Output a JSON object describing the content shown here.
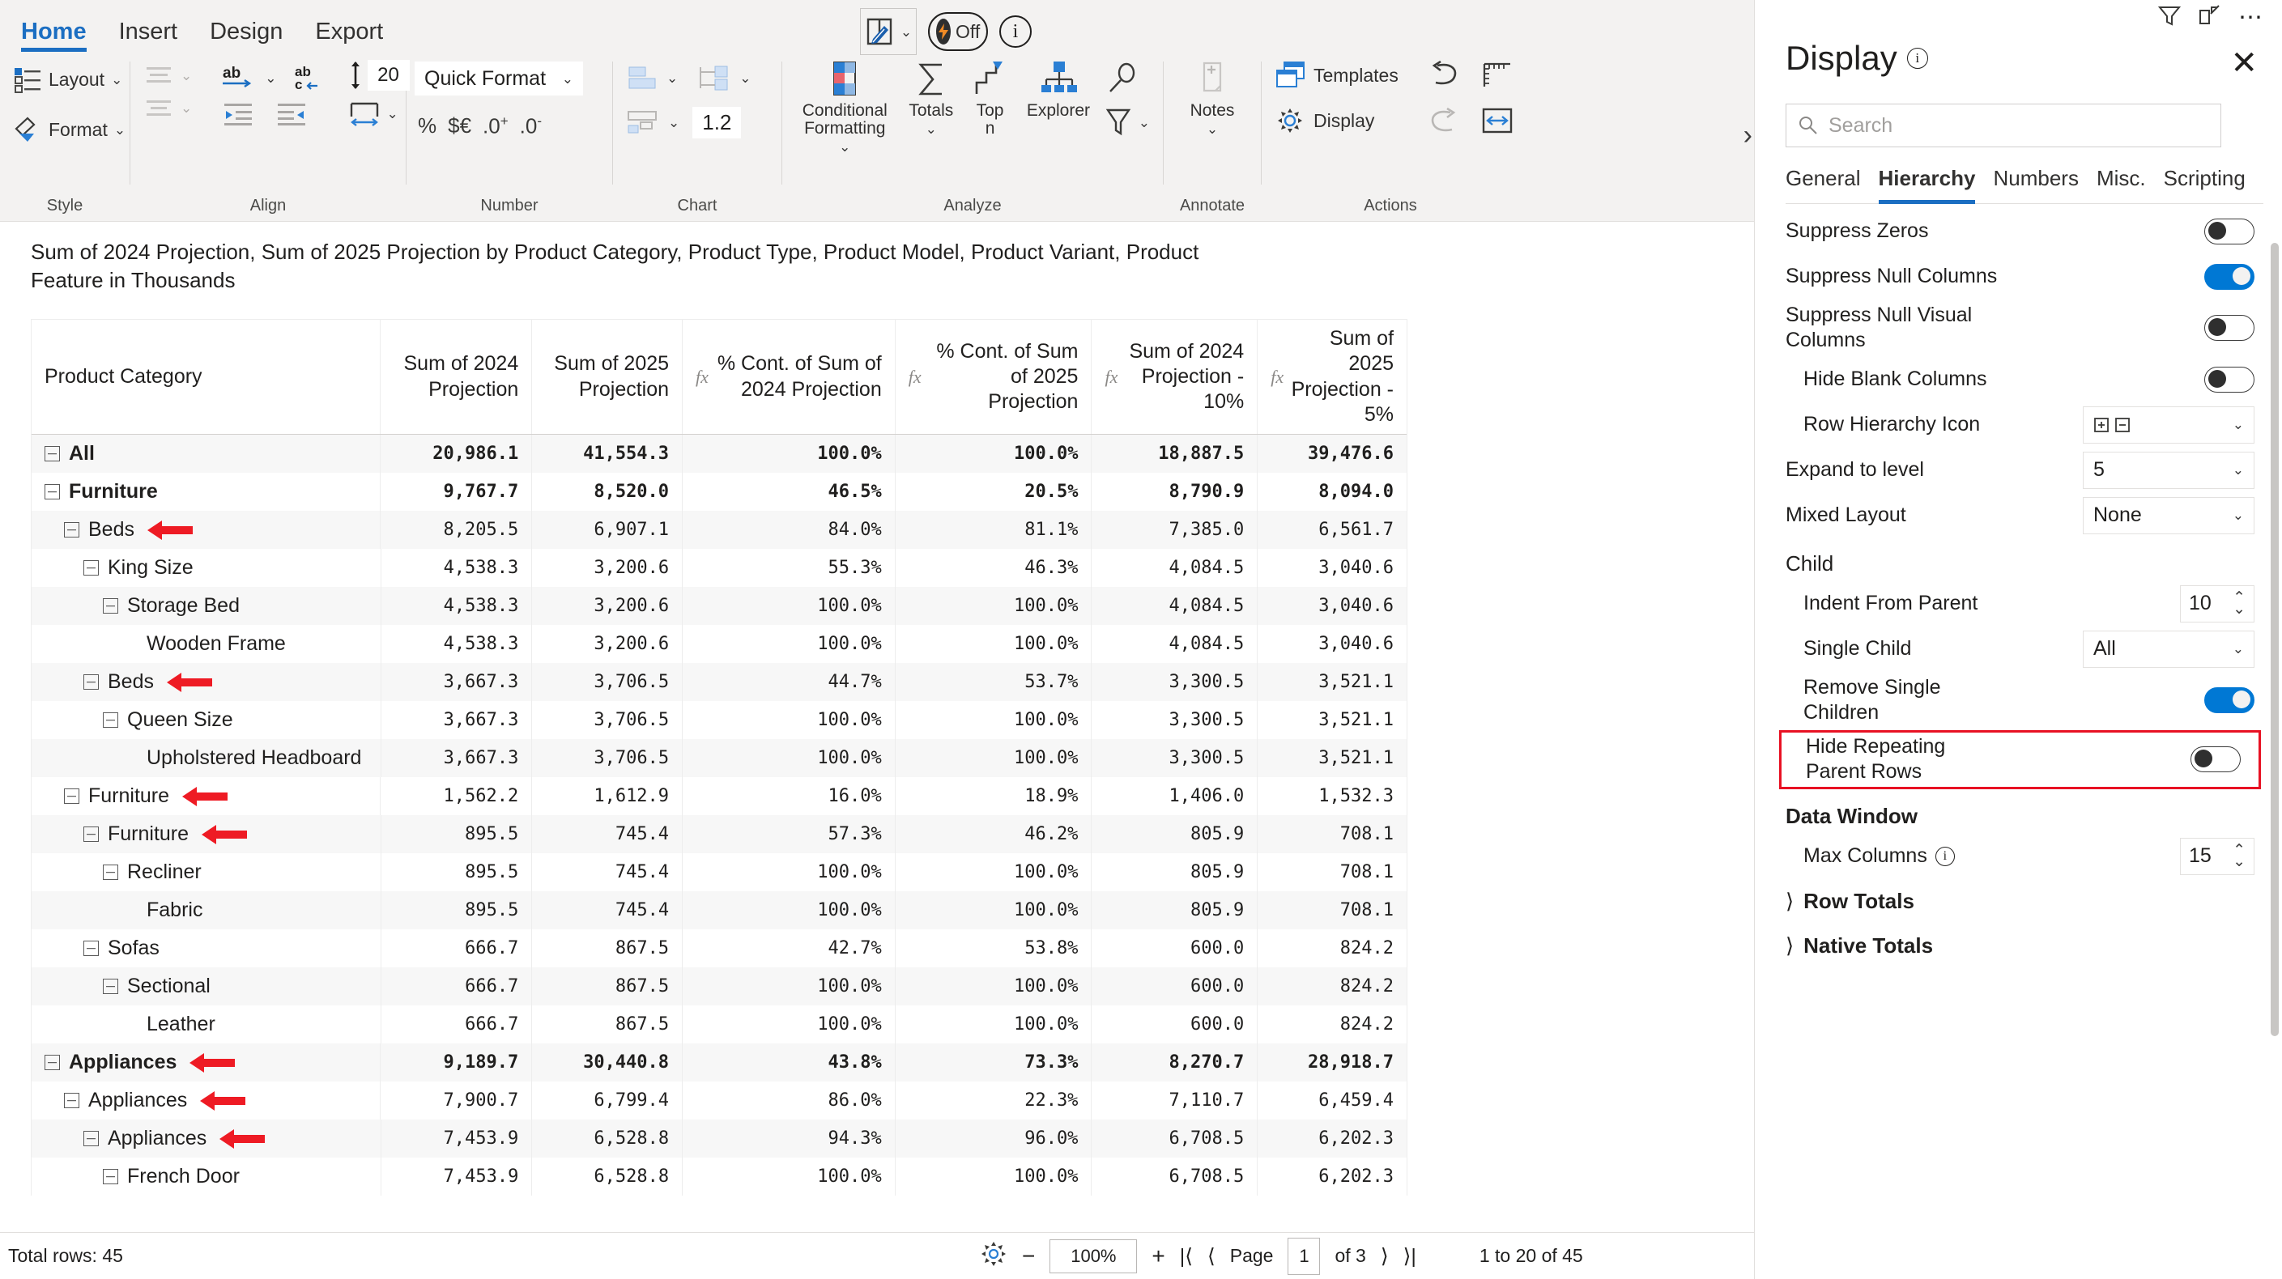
{
  "ribbon": {
    "tabs": [
      {
        "label": "Home",
        "active": true
      },
      {
        "label": "Insert",
        "active": false
      },
      {
        "label": "Design",
        "active": false
      },
      {
        "label": "Export",
        "active": false
      }
    ],
    "groups": [
      {
        "title": "Style",
        "items": [
          "Layout",
          "Format"
        ]
      },
      {
        "title": "Align",
        "items": [
          "20"
        ]
      },
      {
        "title": "Number",
        "items": [
          "Quick Format",
          "%",
          "$€",
          ".0+",
          ".0-"
        ]
      },
      {
        "title": "Chart",
        "items": [
          "1.2"
        ]
      },
      {
        "title": "Analyze",
        "items": [
          "Conditional Formatting",
          "Totals",
          "Top n",
          "Explorer"
        ]
      },
      {
        "title": "Annotate",
        "items": [
          "Notes"
        ]
      },
      {
        "title": "Actions",
        "items": [
          "Templates",
          "Display"
        ]
      }
    ],
    "style": {
      "layout_label": "Layout",
      "format_label": "Format",
      "group_title": "Style"
    },
    "align": {
      "line_spacing_value": "20",
      "group_title": "Align"
    },
    "number": {
      "quick_format_label": "Quick Format",
      "percent_label": "%",
      "currency_label": "$€",
      "inc_dec_label": ".0",
      "dec_dec_label": ".0",
      "group_title": "Number"
    },
    "chart": {
      "decimals_label": "1.2",
      "group_title": "Chart"
    },
    "analyze": {
      "conditional_formatting_label": "Conditional Formatting",
      "totals_label": "Totals",
      "topn_label": "Top n",
      "explorer_label": "Explorer",
      "group_title": "Analyze"
    },
    "annotate": {
      "notes_label": "Notes",
      "group_title": "Annotate"
    },
    "actions": {
      "templates_label": "Templates",
      "display_label": "Display",
      "group_title": "Actions"
    },
    "center": {
      "toggle_label": "Off"
    }
  },
  "report": {
    "title": "Sum of 2024 Projection, Sum of 2025 Projection by Product Category, Product Type, Product Model, Product Variant, Product Feature in Thousands",
    "columns": [
      {
        "label": "Product Category",
        "fx": false,
        "type": "name"
      },
      {
        "label": "Sum of 2024 Projection",
        "fx": false,
        "type": "num"
      },
      {
        "label": "Sum of 2025 Projection",
        "fx": false,
        "type": "num"
      },
      {
        "label": "% Cont. of Sum of 2024 Projection",
        "fx": true,
        "type": "num"
      },
      {
        "label": "% Cont. of Sum of 2025 Projection",
        "fx": true,
        "type": "num"
      },
      {
        "label": "Sum of 2024 Projection - 10%",
        "fx": true,
        "type": "num"
      },
      {
        "label": "Sum of 2025 Projection - 5%",
        "fx": true,
        "type": "num"
      }
    ],
    "rows": [
      {
        "name": "All",
        "level": 0,
        "expander": true,
        "bold": true,
        "arrow": false,
        "values": [
          "20,986.1",
          "41,554.3",
          "100.0%",
          "100.0%",
          "18,887.5",
          "39,476.6"
        ]
      },
      {
        "name": "Furniture",
        "level": 0,
        "expander": true,
        "bold": true,
        "arrow": false,
        "values": [
          "9,767.7",
          "8,520.0",
          "46.5%",
          "20.5%",
          "8,790.9",
          "8,094.0"
        ]
      },
      {
        "name": "Beds",
        "level": 1,
        "expander": true,
        "bold": false,
        "arrow": true,
        "values": [
          "8,205.5",
          "6,907.1",
          "84.0%",
          "81.1%",
          "7,385.0",
          "6,561.7"
        ]
      },
      {
        "name": "King Size",
        "level": 2,
        "expander": true,
        "bold": false,
        "arrow": false,
        "values": [
          "4,538.3",
          "3,200.6",
          "55.3%",
          "46.3%",
          "4,084.5",
          "3,040.6"
        ]
      },
      {
        "name": "Storage Bed",
        "level": 3,
        "expander": true,
        "bold": false,
        "arrow": false,
        "values": [
          "4,538.3",
          "3,200.6",
          "100.0%",
          "100.0%",
          "4,084.5",
          "3,040.6"
        ]
      },
      {
        "name": "Wooden Frame",
        "level": 4,
        "expander": false,
        "bold": false,
        "arrow": false,
        "values": [
          "4,538.3",
          "3,200.6",
          "100.0%",
          "100.0%",
          "4,084.5",
          "3,040.6"
        ]
      },
      {
        "name": "Beds",
        "level": 2,
        "expander": true,
        "bold": false,
        "arrow": true,
        "values": [
          "3,667.3",
          "3,706.5",
          "44.7%",
          "53.7%",
          "3,300.5",
          "3,521.1"
        ]
      },
      {
        "name": "Queen Size",
        "level": 3,
        "expander": true,
        "bold": false,
        "arrow": false,
        "values": [
          "3,667.3",
          "3,706.5",
          "100.0%",
          "100.0%",
          "3,300.5",
          "3,521.1"
        ]
      },
      {
        "name": "Upholstered Headboard",
        "level": 4,
        "expander": false,
        "bold": false,
        "arrow": false,
        "values": [
          "3,667.3",
          "3,706.5",
          "100.0%",
          "100.0%",
          "3,300.5",
          "3,521.1"
        ]
      },
      {
        "name": "Furniture",
        "level": 1,
        "expander": true,
        "bold": false,
        "arrow": true,
        "values": [
          "1,562.2",
          "1,612.9",
          "16.0%",
          "18.9%",
          "1,406.0",
          "1,532.3"
        ]
      },
      {
        "name": "Furniture",
        "level": 2,
        "expander": true,
        "bold": false,
        "arrow": true,
        "values": [
          "895.5",
          "745.4",
          "57.3%",
          "46.2%",
          "805.9",
          "708.1"
        ]
      },
      {
        "name": "Recliner",
        "level": 3,
        "expander": true,
        "bold": false,
        "arrow": false,
        "values": [
          "895.5",
          "745.4",
          "100.0%",
          "100.0%",
          "805.9",
          "708.1"
        ]
      },
      {
        "name": "Fabric",
        "level": 4,
        "expander": false,
        "bold": false,
        "arrow": false,
        "values": [
          "895.5",
          "745.4",
          "100.0%",
          "100.0%",
          "805.9",
          "708.1"
        ]
      },
      {
        "name": "Sofas",
        "level": 2,
        "expander": true,
        "bold": false,
        "arrow": false,
        "values": [
          "666.7",
          "867.5",
          "42.7%",
          "53.8%",
          "600.0",
          "824.2"
        ]
      },
      {
        "name": "Sectional",
        "level": 3,
        "expander": true,
        "bold": false,
        "arrow": false,
        "values": [
          "666.7",
          "867.5",
          "100.0%",
          "100.0%",
          "600.0",
          "824.2"
        ]
      },
      {
        "name": "Leather",
        "level": 4,
        "expander": false,
        "bold": false,
        "arrow": false,
        "values": [
          "666.7",
          "867.5",
          "100.0%",
          "100.0%",
          "600.0",
          "824.2"
        ]
      },
      {
        "name": "Appliances",
        "level": 0,
        "expander": true,
        "bold": true,
        "arrow": true,
        "values": [
          "9,189.7",
          "30,440.8",
          "43.8%",
          "73.3%",
          "8,270.7",
          "28,918.7"
        ]
      },
      {
        "name": "Appliances",
        "level": 1,
        "expander": true,
        "bold": false,
        "arrow": true,
        "values": [
          "7,900.7",
          "6,799.4",
          "86.0%",
          "22.3%",
          "7,110.7",
          "6,459.4"
        ]
      },
      {
        "name": "Appliances",
        "level": 2,
        "expander": true,
        "bold": false,
        "arrow": true,
        "values": [
          "7,453.9",
          "6,528.8",
          "94.3%",
          "96.0%",
          "6,708.5",
          "6,202.3"
        ]
      },
      {
        "name": "French Door",
        "level": 3,
        "expander": true,
        "bold": false,
        "arrow": false,
        "values": [
          "7,453.9",
          "6,528.8",
          "100.0%",
          "100.0%",
          "6,708.5",
          "6,202.3"
        ]
      }
    ]
  },
  "status": {
    "total_rows": "Total rows: 45",
    "zoom": "100%",
    "page_label": "Page",
    "page_value": "1",
    "page_of": "of 3",
    "range": "1 to 20 of 45"
  },
  "panel": {
    "title": "Display",
    "search_placeholder": "Search",
    "tabs": [
      {
        "label": "General",
        "active": false
      },
      {
        "label": "Hierarchy",
        "active": true
      },
      {
        "label": "Numbers",
        "active": false
      },
      {
        "label": "Misc.",
        "active": false
      },
      {
        "label": "Scripting",
        "active": false
      }
    ],
    "settings": [
      {
        "kind": "toggle",
        "label": "Suppress Zeros",
        "value": "off",
        "indent": false
      },
      {
        "kind": "toggle",
        "label": "Suppress Null Columns",
        "value": "on",
        "indent": false
      },
      {
        "kind": "toggle",
        "label": "Suppress Null Visual Columns",
        "value": "off",
        "indent": false
      },
      {
        "kind": "toggle",
        "label": "Hide Blank Columns",
        "value": "off",
        "indent": true
      },
      {
        "kind": "icon-select",
        "label": "Row Hierarchy Icon",
        "value": "",
        "indent": true
      },
      {
        "kind": "select",
        "label": "Expand to level",
        "value": "5",
        "indent": false
      },
      {
        "kind": "select",
        "label": "Mixed Layout",
        "value": "None",
        "indent": false
      }
    ],
    "child_section": "Child",
    "child_settings": [
      {
        "kind": "stepper",
        "label": "Indent From Parent",
        "value": "10"
      },
      {
        "kind": "select",
        "label": "Single Child",
        "value": "All"
      },
      {
        "kind": "toggle",
        "label": "Remove Single Children",
        "value": "on"
      }
    ],
    "highlighted": {
      "label": "Hide Repeating Parent Rows",
      "value": "off"
    },
    "data_window_section": "Data Window",
    "data_window_settings": [
      {
        "kind": "stepper",
        "label": "Max Columns",
        "value": "15",
        "info": true
      }
    ],
    "collapsed_groups": [
      {
        "label": "Row Totals"
      },
      {
        "label": "Native Totals"
      }
    ]
  },
  "colors": {
    "accent": "#1b6ec2",
    "toggle_on": "#0078d4",
    "highlight": "#e81123",
    "arrow": "#ee1b24",
    "ribbon_bg": "#f3f2f1"
  }
}
